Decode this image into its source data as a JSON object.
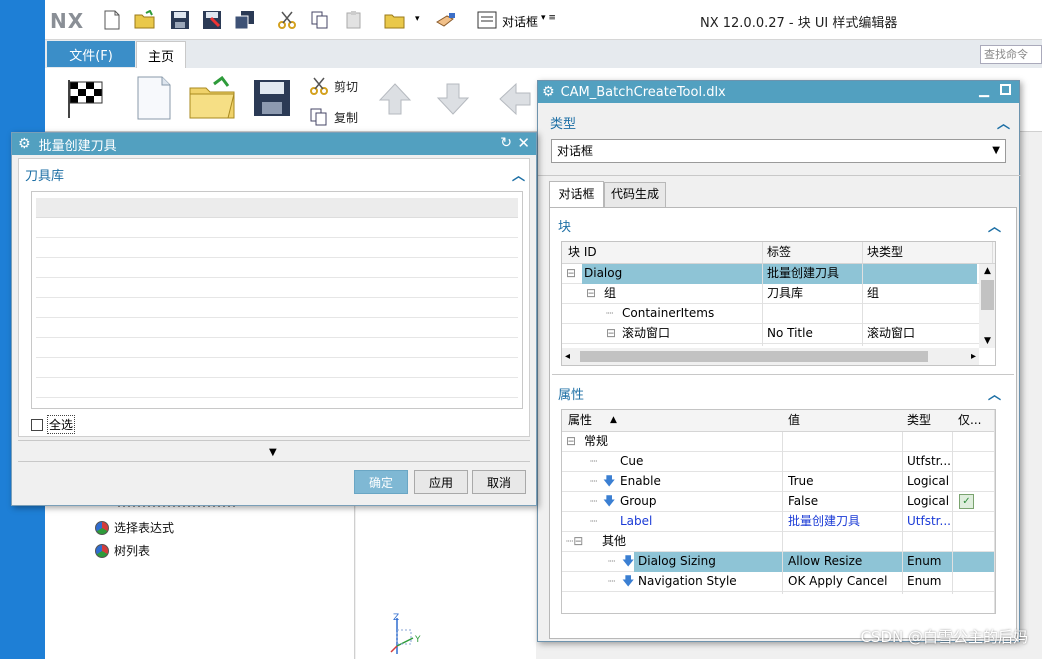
{
  "app": {
    "logo": "NX",
    "title": "NX 12.0.0.27 - 块 UI 样式编辑器",
    "qat_dropdown_label": "对话框",
    "search_placeholder": "查找命令"
  },
  "ribbon": {
    "tabs": [
      {
        "label": "文件(F)"
      },
      {
        "label": "主页"
      }
    ],
    "small_buttons": [
      {
        "label": "剪切"
      },
      {
        "label": "复制"
      }
    ]
  },
  "nav_tree": {
    "items": [
      {
        "label": "选择表达式"
      },
      {
        "label": "树列表"
      }
    ]
  },
  "dialog_batch": {
    "title": "批量创建刀具",
    "section_label": "刀具库",
    "select_all_label": "全选",
    "buttons": {
      "ok": "确定",
      "apply": "应用",
      "cancel": "取消"
    }
  },
  "dialog_cam": {
    "title": "CAM_BatchCreateTool.dlx",
    "type_section": "类型",
    "type_value": "对话框",
    "tabs": [
      {
        "label": "对话框"
      },
      {
        "label": "代码生成"
      }
    ],
    "block_section": "块",
    "block_columns": [
      "块 ID",
      "标签",
      "块类型"
    ],
    "block_rows": [
      {
        "id": "Dialog",
        "label": "批量创建刀具",
        "type": "",
        "selected": true
      },
      {
        "id": "组",
        "label": "刀具库",
        "type": "组",
        "selected": false
      },
      {
        "id": "ContainerItems",
        "label": "",
        "type": "",
        "selected": false
      },
      {
        "id": "滚动窗口",
        "label": "No Title",
        "type": "滚动窗口",
        "selected": false
      }
    ],
    "props_section": "属性",
    "props_columns": [
      "属性",
      "值",
      "类型",
      "仅..."
    ],
    "props_rows": [
      {
        "name": "常规",
        "value": "",
        "type": "",
        "group": true
      },
      {
        "name": "Cue",
        "value": "",
        "type": "Utfstr...",
        "group": false
      },
      {
        "name": "Enable",
        "value": "True",
        "type": "Logical",
        "group": false
      },
      {
        "name": "Group",
        "value": "False",
        "type": "Logical",
        "group": false
      },
      {
        "name": "Label",
        "value": "批量创建刀具",
        "type": "Utfstr...",
        "group": false,
        "modified": true
      },
      {
        "name": "其他",
        "value": "",
        "type": "",
        "group": true
      },
      {
        "name": "Dialog Sizing",
        "value": "Allow Resize",
        "type": "Enum",
        "group": false,
        "selected": true
      },
      {
        "name": "Navigation Style",
        "value": "OK Apply Cancel",
        "type": "Enum",
        "group": false
      }
    ]
  },
  "axis_labels": {
    "z": "Z",
    "y": "Y"
  },
  "watermark": "CSDN @白雪公主的后妈"
}
